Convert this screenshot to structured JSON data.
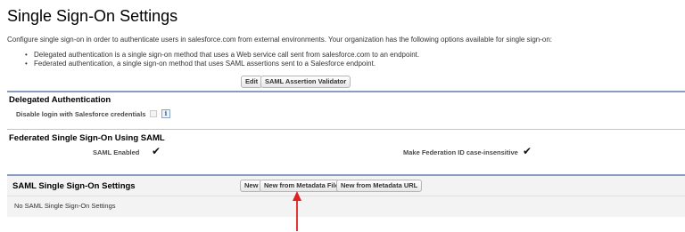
{
  "header": {
    "title": "Single Sign-On Settings",
    "description": "Configure single sign-on in order to authenticate users in salesforce.com from external environments. Your organization has the following options available for single sign-on:",
    "bullets": [
      "Delegated authentication is a single sign-on method that uses a Web service call sent from salesforce.com to an endpoint.",
      "Federated authentication, a single sign-on method that uses SAML assertions sent to a Salesforce endpoint."
    ]
  },
  "toolbar": {
    "edit_label": "Edit",
    "validator_label": "SAML Assertion Validator"
  },
  "delegated": {
    "title": "Delegated Authentication",
    "disable_login_label": "Disable login with Salesforce credentials",
    "info_icon_glyph": "i"
  },
  "federated": {
    "title": "Federated Single Sign-On Using SAML",
    "saml_enabled_label": "SAML Enabled",
    "saml_enabled_value": "✔",
    "case_insensitive_label": "Make Federation ID case-insensitive",
    "case_insensitive_value": "✔"
  },
  "saml_settings": {
    "title": "SAML Single Sign-On Settings",
    "new_label": "New",
    "new_from_file_label": "New from Metadata File",
    "new_from_url_label": "New from Metadata URL",
    "empty_text": "No SAML Single Sign-On Settings"
  },
  "annotation": {
    "arrow_color": "#e02020"
  }
}
